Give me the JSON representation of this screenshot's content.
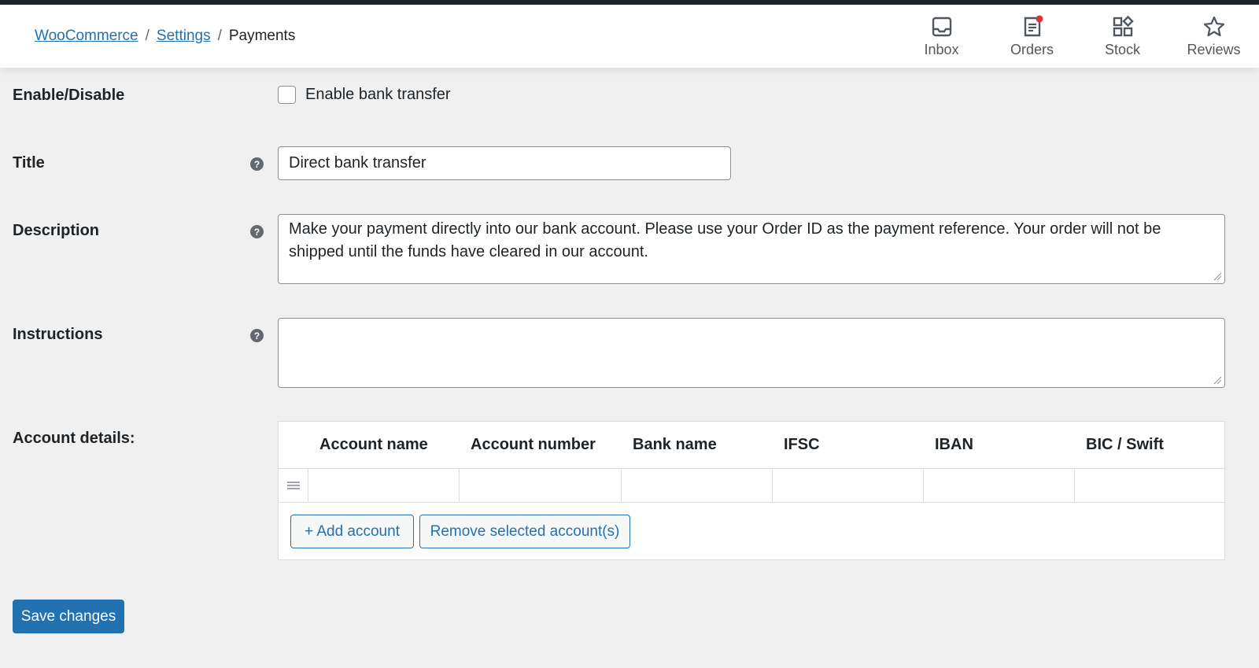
{
  "breadcrumb": {
    "items": [
      "WooCommerce",
      "Settings"
    ],
    "separator": "/",
    "current": "Payments"
  },
  "activity_bar": [
    {
      "label": "Inbox",
      "icon": "inbox-icon"
    },
    {
      "label": "Orders",
      "icon": "orders-icon",
      "notification": true
    },
    {
      "label": "Stock",
      "icon": "stock-icon"
    },
    {
      "label": "Reviews",
      "icon": "star-icon"
    }
  ],
  "form": {
    "enable": {
      "label": "Enable/Disable",
      "checkbox_label": "Enable bank transfer",
      "checked": false
    },
    "title": {
      "label": "Title",
      "value": "Direct bank transfer"
    },
    "description": {
      "label": "Description",
      "value": "Make your payment directly into our bank account. Please use your Order ID as the payment reference. Your order will not be shipped until the funds have cleared in our account."
    },
    "instructions": {
      "label": "Instructions",
      "value": ""
    },
    "account_details": {
      "label": "Account details:",
      "columns": [
        "Account name",
        "Account number",
        "Bank name",
        "IFSC",
        "IBAN",
        "BIC / Swift"
      ],
      "add_label": "+ Add account",
      "remove_label": "Remove selected account(s)"
    },
    "help_glyph": "?"
  },
  "save_label": "Save changes",
  "colors": {
    "accent": "#2271b1",
    "notification": "#d63638",
    "background": "#f0f0f1"
  }
}
